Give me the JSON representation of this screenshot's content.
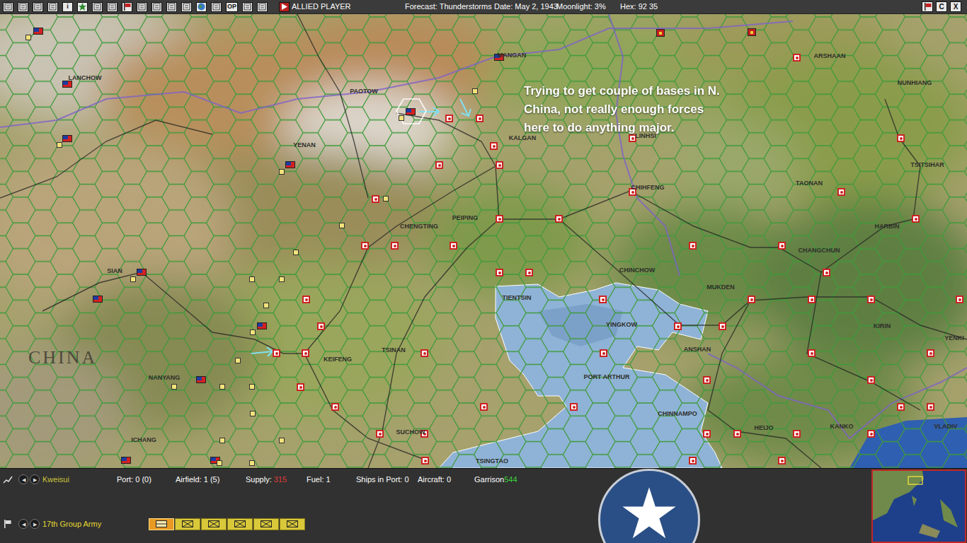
{
  "top_bar": {
    "toolbar": [
      {
        "kind": "icon"
      },
      {
        "kind": "icon"
      },
      {
        "kind": "icon"
      },
      {
        "kind": "icon"
      },
      {
        "kind": "text",
        "label": "i"
      },
      {
        "kind": "star"
      },
      {
        "kind": "icon"
      },
      {
        "kind": "icon"
      },
      {
        "kind": "flag"
      },
      {
        "kind": "icon"
      },
      {
        "kind": "icon"
      },
      {
        "kind": "icon"
      },
      {
        "kind": "icon"
      },
      {
        "kind": "globe"
      },
      {
        "kind": "icon"
      },
      {
        "kind": "text",
        "label": "OP"
      },
      {
        "kind": "icon"
      },
      {
        "kind": "icon"
      },
      {
        "kind": "play"
      }
    ],
    "player": "ALLIED PLAYER",
    "forecast": "Forecast: Thunderstorms",
    "date": "Date: May 2, 1943",
    "moonlight": "Moonlight: 3%",
    "hex": "Hex: 92 35",
    "buttons": [
      {
        "label": "C"
      },
      {
        "label": "X"
      }
    ]
  },
  "map": {
    "region_label": "CHINA",
    "annotation": [
      "Trying to get couple of bases in N.",
      "China, not really enough forces",
      "here to do anything major."
    ],
    "cities": [
      {
        "name": "LANCHOW"
      },
      {
        "name": "PAOTOW"
      },
      {
        "name": "MANGAN"
      },
      {
        "name": "ARSHAAN"
      },
      {
        "name": "NUNHIANG"
      },
      {
        "name": "YENAN"
      },
      {
        "name": "KALGAN"
      },
      {
        "name": "LINHSI"
      },
      {
        "name": "TSITSIHAR"
      },
      {
        "name": "CHIHFENG"
      },
      {
        "name": "TAONAN"
      },
      {
        "name": "HARBIN"
      },
      {
        "name": "CHENGTING"
      },
      {
        "name": "PEIPING"
      },
      {
        "name": "CHANGCHUN"
      },
      {
        "name": "CHINCHOW"
      },
      {
        "name": "MUKDEN"
      },
      {
        "name": "SIAN"
      },
      {
        "name": "TIENTSIN"
      },
      {
        "name": "YINGKOW"
      },
      {
        "name": "KIRIN"
      },
      {
        "name": "ANSHAN"
      },
      {
        "name": "KEIFENG"
      },
      {
        "name": "TSINAN"
      },
      {
        "name": "PORT ARTHUR"
      },
      {
        "name": "YENKI"
      },
      {
        "name": "NANYANG"
      },
      {
        "name": "CHINNAMPO"
      },
      {
        "name": "SUCHOW"
      },
      {
        "name": "HEIJO"
      },
      {
        "name": "KANKO"
      },
      {
        "name": "VLADIV"
      },
      {
        "name": "ICHANG"
      },
      {
        "name": "TSINGTAO"
      }
    ],
    "markers": [
      {
        "kind": "japan"
      },
      {
        "kind": "japan"
      },
      {
        "kind": "japan"
      },
      {
        "kind": "japan"
      },
      {
        "kind": "japan"
      },
      {
        "kind": "japan"
      },
      {
        "kind": "japan"
      },
      {
        "kind": "japan"
      },
      {
        "kind": "japan"
      },
      {
        "kind": "japan"
      },
      {
        "kind": "japan"
      },
      {
        "kind": "japan"
      },
      {
        "kind": "japan"
      },
      {
        "kind": "japan"
      },
      {
        "kind": "japan"
      },
      {
        "kind": "japan"
      },
      {
        "kind": "japan"
      },
      {
        "kind": "japan"
      },
      {
        "kind": "japan"
      },
      {
        "kind": "japan"
      },
      {
        "kind": "japan"
      },
      {
        "kind": "japan"
      },
      {
        "kind": "japan"
      },
      {
        "kind": "japan"
      },
      {
        "kind": "japan"
      },
      {
        "kind": "japan"
      },
      {
        "kind": "japan"
      },
      {
        "kind": "japan"
      },
      {
        "kind": "japan"
      },
      {
        "kind": "japan"
      },
      {
        "kind": "japan"
      },
      {
        "kind": "japan"
      },
      {
        "kind": "japan"
      },
      {
        "kind": "japan"
      },
      {
        "kind": "japan"
      },
      {
        "kind": "japan"
      },
      {
        "kind": "japan"
      },
      {
        "kind": "japan"
      },
      {
        "kind": "japan"
      },
      {
        "kind": "japan"
      },
      {
        "kind": "japan"
      },
      {
        "kind": "japan"
      },
      {
        "kind": "japan"
      },
      {
        "kind": "japan"
      },
      {
        "kind": "japan"
      },
      {
        "kind": "japan"
      },
      {
        "kind": "japan"
      },
      {
        "kind": "japan"
      },
      {
        "kind": "japan"
      },
      {
        "kind": "japan"
      },
      {
        "kind": "japan"
      },
      {
        "kind": "japan"
      },
      {
        "kind": "japan"
      },
      {
        "kind": "japan"
      },
      {
        "kind": "china"
      },
      {
        "kind": "china"
      },
      {
        "kind": "china"
      },
      {
        "kind": "china"
      },
      {
        "kind": "china"
      },
      {
        "kind": "china"
      },
      {
        "kind": "china"
      },
      {
        "kind": "china"
      },
      {
        "kind": "china"
      },
      {
        "kind": "china"
      },
      {
        "kind": "china"
      },
      {
        "kind": "china"
      },
      {
        "kind": "base"
      },
      {
        "kind": "base"
      },
      {
        "kind": "base"
      },
      {
        "kind": "base"
      },
      {
        "kind": "base"
      },
      {
        "kind": "base"
      },
      {
        "kind": "base"
      },
      {
        "kind": "base"
      },
      {
        "kind": "base"
      },
      {
        "kind": "base"
      },
      {
        "kind": "base"
      },
      {
        "kind": "base"
      },
      {
        "kind": "base"
      },
      {
        "kind": "base"
      },
      {
        "kind": "base"
      },
      {
        "kind": "base"
      },
      {
        "kind": "base"
      },
      {
        "kind": "base"
      },
      {
        "kind": "base"
      },
      {
        "kind": "base"
      },
      {
        "kind": "base"
      },
      {
        "kind": "base"
      },
      {
        "kind": "soviet"
      },
      {
        "kind": "soviet"
      }
    ]
  },
  "hex_panel": {
    "nav": [
      "◀",
      "▶"
    ],
    "base": "Kweisui",
    "port": "Port: 0 (0)",
    "airfield": "Airfield: 1 (5)",
    "supply_label": "Supply:",
    "supply_value": "315",
    "fuel": "Fuel: 1",
    "ships": "Ships in Port: 0",
    "aircraft": "Aircraft: 0",
    "garrison_label": "Garrison",
    "garrison_value": "544"
  },
  "unit_panel": {
    "nav": [
      "◀",
      "▶"
    ],
    "unit": "17th Group Army",
    "counters": [
      {
        "kind": "hq",
        "selected": true
      },
      {
        "kind": "infantry",
        "selected": false
      },
      {
        "kind": "infantry",
        "selected": false
      },
      {
        "kind": "infantry",
        "selected": false
      },
      {
        "kind": "infantry",
        "selected": false
      },
      {
        "kind": "infantry",
        "selected": false
      }
    ]
  }
}
